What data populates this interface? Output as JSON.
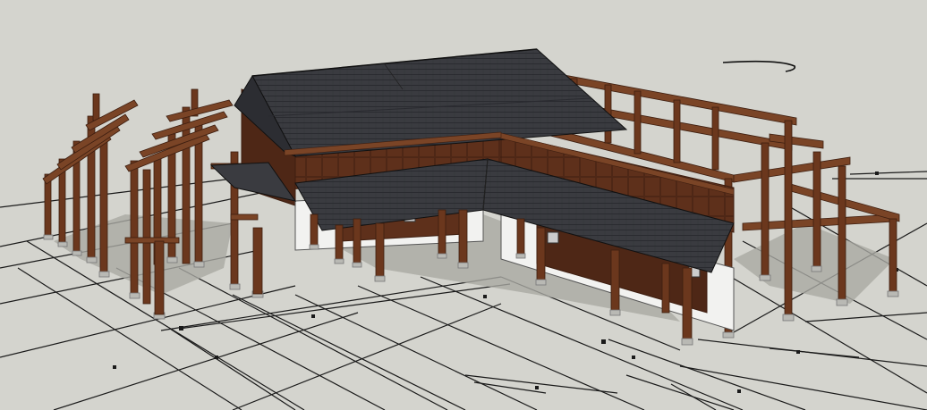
{
  "scene": {
    "description_visible_text": "",
    "colors": {
      "background": "#d4d4ce",
      "ground_lines": "#1a1a1a",
      "roof": "#3a3b40",
      "roof_light": "#4a4b52",
      "timber": "#5a2f1a",
      "timber_light": "#7a4426",
      "timber_dark": "#3d1e10",
      "wall_white": "#f2f2f0",
      "wall_panel": "#4e2716",
      "column_base": "#b9b9b4"
    }
  }
}
